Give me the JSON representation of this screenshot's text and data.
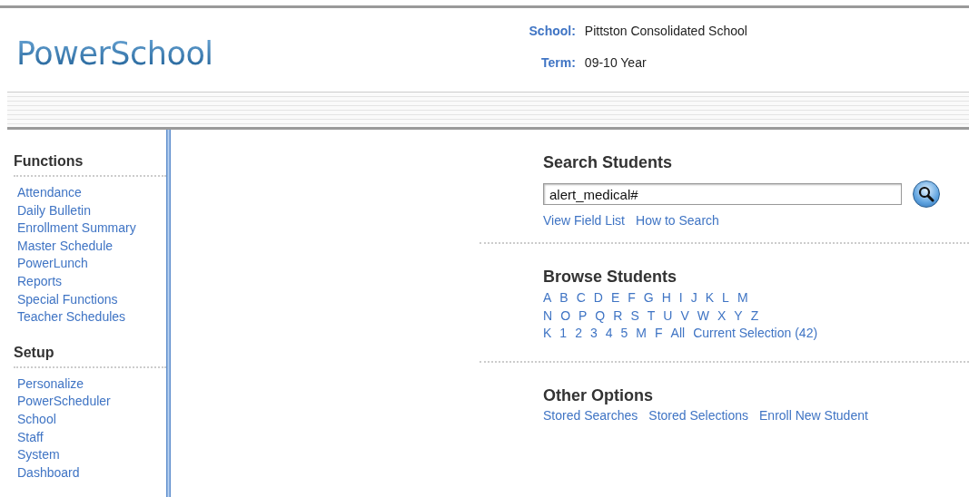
{
  "header": {
    "logo": "PowerSchool",
    "info": [
      {
        "label": "School:",
        "value": "Pittston Consolidated School"
      },
      {
        "label": "Term:",
        "value": "09-10 Year"
      }
    ]
  },
  "sidebar": {
    "sections": [
      {
        "title": "Functions",
        "items": [
          "Attendance",
          "Daily Bulletin",
          "Enrollment Summary",
          "Master Schedule",
          "PowerLunch",
          "Reports",
          "Special Functions",
          "Teacher Schedules"
        ]
      },
      {
        "title": "Setup",
        "items": [
          "Personalize",
          "PowerScheduler",
          "School",
          "Staff",
          "System",
          "Dashboard"
        ]
      }
    ]
  },
  "search": {
    "title": "Search Students",
    "value": "alert_medical#",
    "links": [
      "View Field List",
      "How to Search"
    ]
  },
  "browse": {
    "title": "Browse Students",
    "rows": [
      [
        "A",
        "B",
        "C",
        "D",
        "E",
        "F",
        "G",
        "H",
        "I",
        "J",
        "K",
        "L",
        "M"
      ],
      [
        "N",
        "O",
        "P",
        "Q",
        "R",
        "S",
        "T",
        "U",
        "V",
        "W",
        "X",
        "Y",
        "Z"
      ],
      [
        "K",
        "1",
        "2",
        "3",
        "4",
        "5",
        "M",
        "F",
        "All",
        "Current Selection (42)"
      ]
    ]
  },
  "other": {
    "title": "Other Options",
    "links": [
      "Stored Searches",
      "Stored Selections",
      "Enroll New Student"
    ]
  }
}
